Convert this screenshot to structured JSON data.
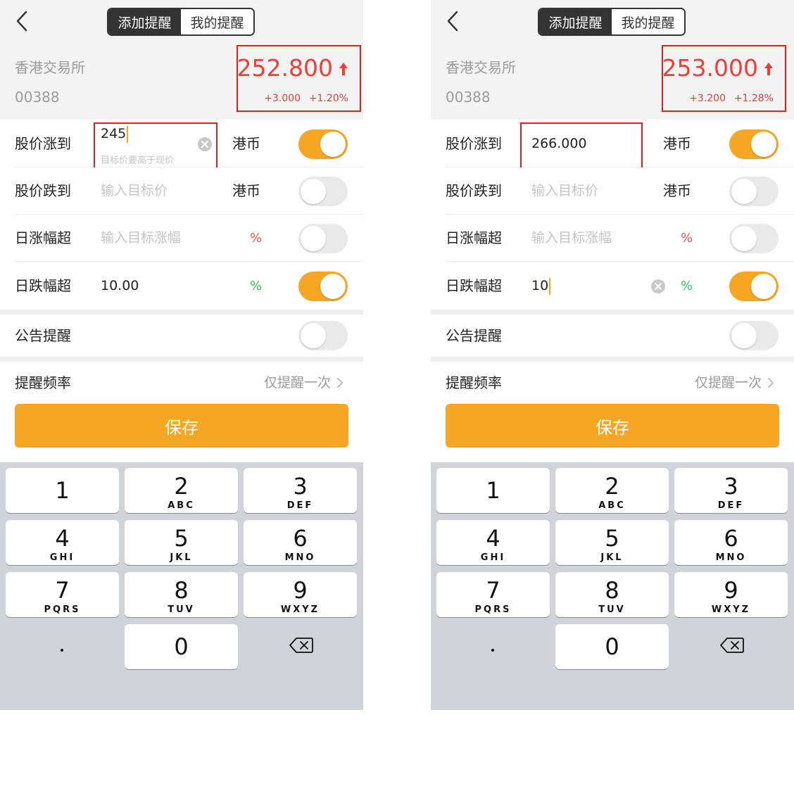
{
  "screens": [
    {
      "tabs": {
        "add": "添加提醒",
        "mine": "我的提醒"
      },
      "stock": {
        "exchange": "香港交易所",
        "code": "00388",
        "price": "252.800",
        "change": "+3.000",
        "change_pct": "+1.20%"
      },
      "rows": {
        "rise": {
          "label": "股价涨到",
          "value": "245",
          "hint": "目标价要高于现价",
          "unit": "港币",
          "toggle_on": true
        },
        "fall": {
          "label": "股价跌到",
          "placeholder": "输入目标价",
          "unit": "港币",
          "toggle_on": false
        },
        "day_up": {
          "label": "日涨幅超",
          "placeholder": "输入目标涨幅",
          "unit": "%",
          "toggle_on": false
        },
        "day_down": {
          "label": "日跌幅超",
          "value": "10.00",
          "unit": "%",
          "toggle_on": true
        },
        "notice": {
          "label": "公告提醒",
          "toggle_on": false
        },
        "frequency": {
          "label": "提醒频率",
          "value": "仅提醒一次"
        }
      },
      "save_label": "保存"
    },
    {
      "tabs": {
        "add": "添加提醒",
        "mine": "我的提醒"
      },
      "stock": {
        "exchange": "香港交易所",
        "code": "00388",
        "price": "253.000",
        "change": "+3.200",
        "change_pct": "+1.28%"
      },
      "rows": {
        "rise": {
          "label": "股价涨到",
          "value": "266.000",
          "unit": "港币",
          "toggle_on": true
        },
        "fall": {
          "label": "股价跌到",
          "placeholder": "输入目标价",
          "unit": "港币",
          "toggle_on": false
        },
        "day_up": {
          "label": "日涨幅超",
          "placeholder": "输入目标涨幅",
          "unit": "%",
          "toggle_on": false
        },
        "day_down": {
          "label": "日跌幅超",
          "value": "10",
          "unit": "%",
          "toggle_on": true
        },
        "notice": {
          "label": "公告提醒",
          "toggle_on": false
        },
        "frequency": {
          "label": "提醒频率",
          "value": "仅提醒一次"
        }
      },
      "save_label": "保存"
    }
  ],
  "keypad": {
    "keys": [
      {
        "digit": "1",
        "letters": ""
      },
      {
        "digit": "2",
        "letters": "ABC"
      },
      {
        "digit": "3",
        "letters": "DEF"
      },
      {
        "digit": "4",
        "letters": "GHI"
      },
      {
        "digit": "5",
        "letters": "JKL"
      },
      {
        "digit": "6",
        "letters": "MNO"
      },
      {
        "digit": "7",
        "letters": "PQRS"
      },
      {
        "digit": "8",
        "letters": "TUV"
      },
      {
        "digit": "9",
        "letters": "WXYZ"
      },
      {
        "digit": "0",
        "letters": ""
      }
    ],
    "decimal": "."
  },
  "colors": {
    "accent": "#f5a623",
    "up": "#ec3f3a",
    "down": "#3cbf62",
    "highlight_box": "#e21f1f"
  },
  "icons": {
    "back": "chevron-left-icon",
    "price_up": "arrow-up-icon",
    "clear": "clear-circle-icon",
    "more": "chevron-right-icon",
    "backspace": "backspace-icon"
  }
}
